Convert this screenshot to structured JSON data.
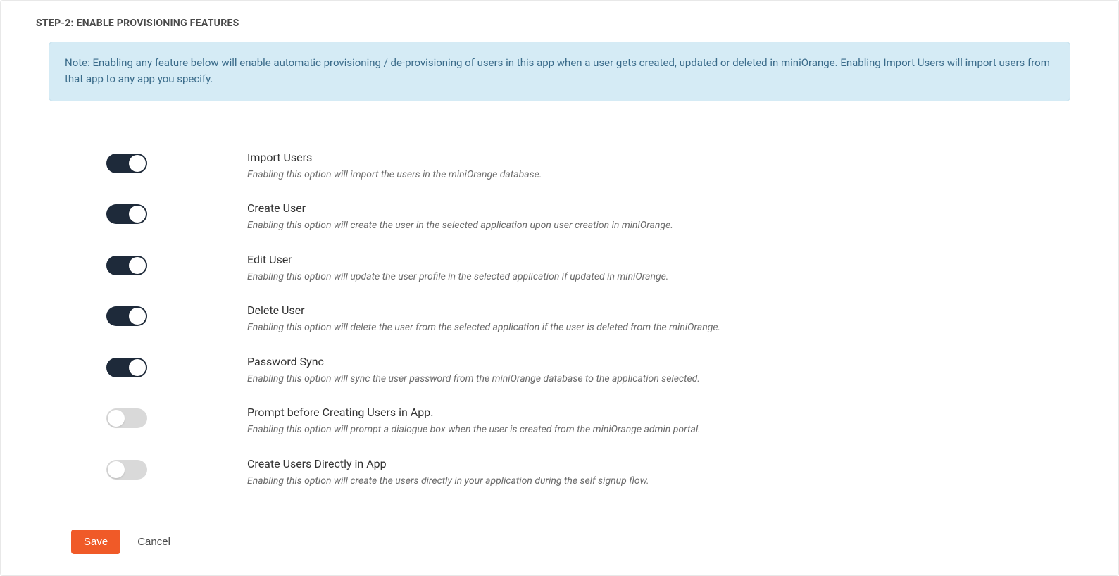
{
  "step": {
    "title": "STEP-2: ENABLE PROVISIONING FEATURES"
  },
  "banner": {
    "text": "Note: Enabling any feature below will enable automatic provisioning / de-provisioning of users in this app when a user gets created, updated or deleted in miniOrange. Enabling Import Users will import users from that app to any app you specify."
  },
  "features": [
    {
      "id": "import-users",
      "title": "Import Users",
      "desc": "Enabling this option will import the users in the miniOrange database.",
      "enabled": true
    },
    {
      "id": "create-user",
      "title": "Create User",
      "desc": "Enabling this option will create the user in the selected application upon user creation in miniOrange.",
      "enabled": true
    },
    {
      "id": "edit-user",
      "title": "Edit User",
      "desc": "Enabling this option will update the user profile in the selected application if updated in miniOrange.",
      "enabled": true
    },
    {
      "id": "delete-user",
      "title": "Delete User",
      "desc": "Enabling this option will delete the user from the selected application if the user is deleted from the miniOrange.",
      "enabled": true
    },
    {
      "id": "password-sync",
      "title": "Password Sync",
      "desc": "Enabling this option will sync the user password from the miniOrange database to the application selected.",
      "enabled": true
    },
    {
      "id": "prompt-before-creating",
      "title": "Prompt before Creating Users in App.",
      "desc": "Enabling this option will prompt a dialogue box when the user is created from the miniOrange admin portal.",
      "enabled": false
    },
    {
      "id": "create-users-directly",
      "title": "Create Users Directly in App",
      "desc": "Enabling this option will create the users directly in your application during the self signup flow.",
      "enabled": false
    }
  ],
  "actions": {
    "save_label": "Save",
    "cancel_label": "Cancel"
  }
}
